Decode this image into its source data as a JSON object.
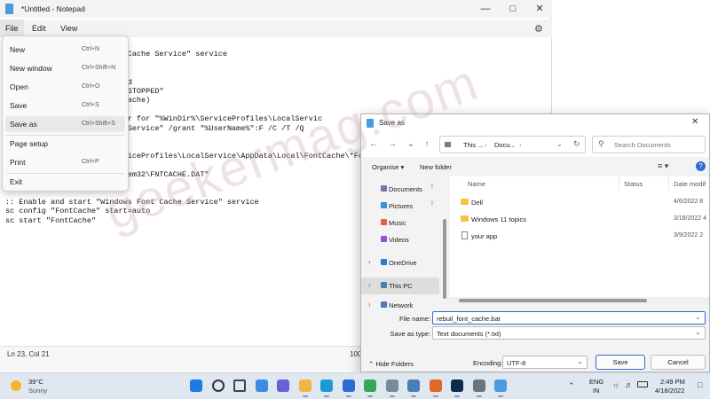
{
  "notepad": {
    "title": "*Untitled - Notepad",
    "menu": [
      "File",
      "Edit",
      "View"
    ],
    "text_lines": [
      "",
      "                      Font Cache Service\" service",
      "",
      "",
      "                    disabled",
      "                    /I /C:\"STOPPED\"",
      "                    o FontCache)",
      "",
      "                current user for \"%WinDir%\\ServiceProfiles\\LocalServic",
      "                files\\LocalService\" /grant \"%UserName%\":F /C /T /Q",
      "",
      "",
      "del /A /F /Q \"%WinDir%\\ServiceProfiles\\LocalService\\AppData\\Local\\FontCache\\*Fon",
      "",
      "del /A /F /Q \"%WinDir%\\System32\\FNTCACHE.DAT\"",
      "",
      "",
      ":: Enable and start \"Windows Font Cache Service\" service",
      "sc config \"FontCache\" start=auto",
      "sc start \"FontCache\""
    ],
    "status_pos": "Ln 23, Col 21",
    "status_zoom": "100"
  },
  "file_menu": {
    "items": [
      {
        "label": "New",
        "shortcut": "Ctrl+N"
      },
      {
        "label": "New window",
        "shortcut": "Ctrl+Shift+N"
      },
      {
        "label": "Open",
        "shortcut": "Ctrl+O"
      },
      {
        "label": "Save",
        "shortcut": "Ctrl+S"
      },
      {
        "label": "Save as",
        "shortcut": "Ctrl+Shift+S"
      },
      {
        "label": "Page setup",
        "shortcut": ""
      },
      {
        "label": "Print",
        "shortcut": "Ctrl+P"
      },
      {
        "label": "Exit",
        "shortcut": ""
      }
    ]
  },
  "watermark": "geekermag.com",
  "dialog": {
    "title": "Save as",
    "address": [
      "This ...",
      "Docu..."
    ],
    "search_placeholder": "Search Documents",
    "organise": "Organise",
    "new_folder": "New folder",
    "nav_items": [
      {
        "label": "Documents",
        "color": "#6b7fa0"
      },
      {
        "label": "Pictures",
        "color": "#3b8fd6"
      },
      {
        "label": "Music",
        "color": "#e0604a"
      },
      {
        "label": "Videos",
        "color": "#9b4fd0"
      },
      {
        "label": "OneDrive",
        "color": "#2b7cd3"
      },
      {
        "label": "This PC",
        "color": "#4a7fb5"
      },
      {
        "label": "Network",
        "color": "#4a7fb5"
      }
    ],
    "columns": [
      "Name",
      "Status",
      "Date modif"
    ],
    "files": [
      {
        "name": "Dell",
        "date": "4/6/2022 8",
        "type": "folder"
      },
      {
        "name": "Windows 11 topics",
        "date": "3/18/2022 4",
        "type": "folder"
      },
      {
        "name": "your app",
        "date": "3/9/2022 2",
        "type": "file"
      }
    ],
    "file_name_label": "File name:",
    "file_name_value": "rebuil_font_cache.bat",
    "save_type_label": "Save as type:",
    "save_type_value": "Text documents (*.txt)",
    "hide_folders": "Hide Folders",
    "encoding_label": "Encoding:",
    "encoding_value": "UTF-8",
    "save_button": "Save",
    "cancel_button": "Cancel"
  },
  "taskbar": {
    "weather_temp": "39°C",
    "weather_desc": "Sunny",
    "lang_1": "ENG",
    "lang_2": "IN",
    "time": "2:49 PM",
    "date": "4/18/2022",
    "icons": [
      {
        "name": "start-icon",
        "color": "#1f7be0"
      },
      {
        "name": "search-icon",
        "color": "#333333"
      },
      {
        "name": "task-view-icon",
        "color": "#444444"
      },
      {
        "name": "widgets-icon",
        "color": "#3d8be0"
      },
      {
        "name": "chat-icon",
        "color": "#6b5fd6"
      },
      {
        "name": "file-explorer-icon",
        "color": "#f2b544"
      },
      {
        "name": "edge-icon",
        "color": "#1b9ad6"
      },
      {
        "name": "store-icon",
        "color": "#2b6cd0"
      },
      {
        "name": "chrome-icon",
        "color": "#34a853"
      },
      {
        "name": "app-icon",
        "color": "#7a8a9a"
      },
      {
        "name": "mail-icon",
        "color": "#4a7fb5"
      },
      {
        "name": "firefox-icon",
        "color": "#e2672b"
      },
      {
        "name": "photoshop-icon",
        "color": "#0d2b4e"
      },
      {
        "name": "settings-icon",
        "color": "#6a7580"
      },
      {
        "name": "notepad-icon",
        "color": "#4a9be0"
      }
    ]
  }
}
